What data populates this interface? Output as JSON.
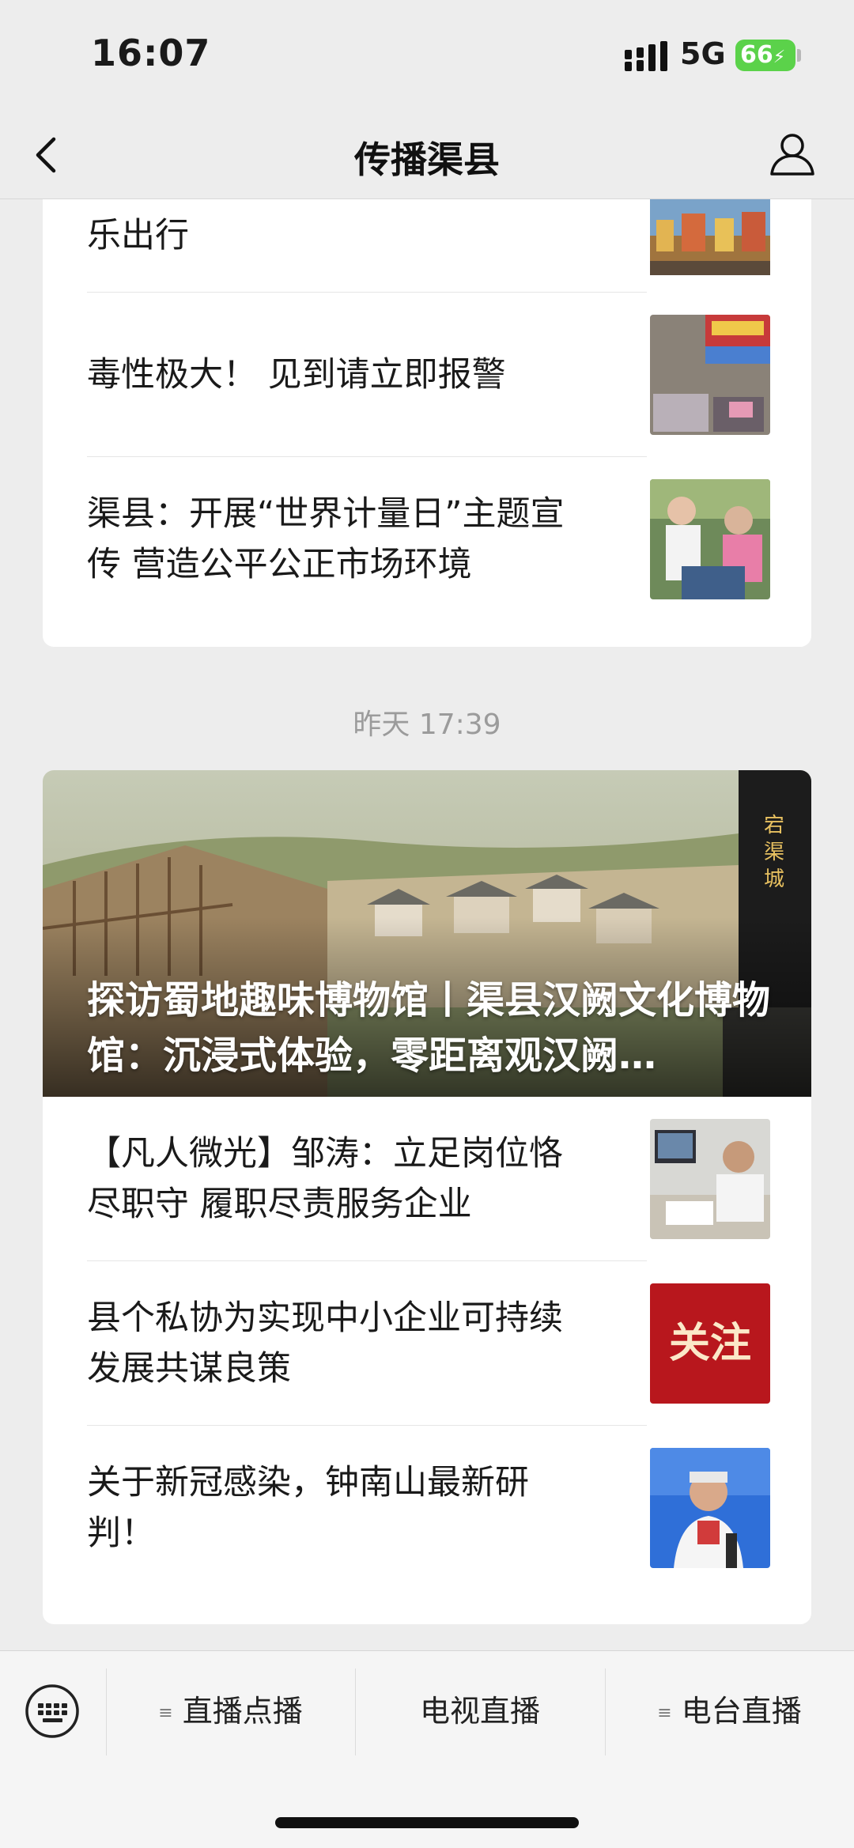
{
  "status_bar": {
    "time": "16:07",
    "network": "5G",
    "battery": "66"
  },
  "nav": {
    "title": "传播渠县"
  },
  "card1": {
    "articles": [
      {
        "title": "乐出行"
      },
      {
        "title": "毒性极大！ 见到请立即报警"
      },
      {
        "title": "渠县：开展“世界计量日”主题宣传 营造公平公正市场环境"
      }
    ]
  },
  "timestamp": "昨天 17:39",
  "card2": {
    "hero": {
      "title": "探访蜀地趣味博物馆丨渠县汉阙文化博物馆：沉浸式体验，零距离观汉阙…",
      "sign_text": "宕渠城"
    },
    "articles": [
      {
        "title": "【凡人微光】邹涛：立足岗位恪尽职守 履职尽责服务企业"
      },
      {
        "title": "县个私协为实现中小企业可持续发展共谋良策",
        "thumb_text": "关注"
      },
      {
        "title": "关于新冠感染，钟南山最新研判！"
      }
    ]
  },
  "bottom_menu": {
    "items": [
      {
        "label": "直播点播",
        "has_submenu": true
      },
      {
        "label": "电视直播",
        "has_submenu": false
      },
      {
        "label": "电台直播",
        "has_submenu": true
      }
    ]
  }
}
